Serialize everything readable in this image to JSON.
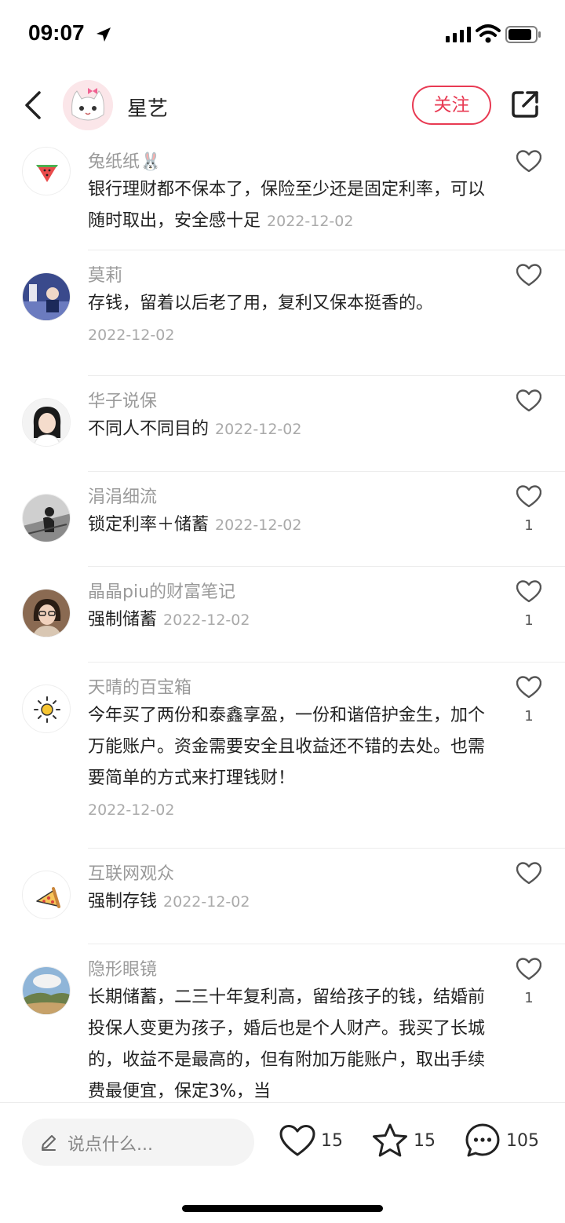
{
  "status_bar": {
    "time": "09:07"
  },
  "header": {
    "name": "星艺",
    "follow_label": "关注"
  },
  "comments": [
    {
      "name": "兔纸纸🐰",
      "text": "银行理财都不保本了，保险至少还是固定利率，可以随时取出，安全感十足",
      "date": "2022-12-02",
      "likes": "",
      "avatar": "watermelon-avatar"
    },
    {
      "name": "莫莉",
      "text": "存钱，留着以后老了用，复利又保本挺香的。",
      "date": "2022-12-02",
      "likes": "",
      "avatar": "photo-avatar"
    },
    {
      "name": "华子说保",
      "text": "不同人不同目的",
      "date": "2022-12-02",
      "likes": "",
      "avatar": "portrait-avatar"
    },
    {
      "name": "涓涓细流",
      "text": "锁定利率＋储蓄",
      "date": "2022-12-02",
      "likes": "1",
      "avatar": "bw-photo-avatar"
    },
    {
      "name": "晶晶piu的财富笔记",
      "text": "强制储蓄",
      "date": "2022-12-02",
      "likes": "1",
      "avatar": "portrait-avatar"
    },
    {
      "name": "天晴的百宝箱",
      "text": "今年买了两份和泰鑫享盈，一份和谐倍护金生，加个万能账户。资金需要安全且收益还不错的去处。也需要简单的方式来打理钱财！",
      "date": "2022-12-02",
      "likes": "1",
      "avatar": "sun-avatar"
    },
    {
      "name": "互联网观众",
      "text": "强制存钱",
      "date": "2022-12-02",
      "likes": "",
      "avatar": "pizza-avatar"
    },
    {
      "name": "隐形眼镜",
      "text": "长期储蓄，二三十年复利高，留给孩子的钱，结婚前投保人变更为孩子，婚后也是个人财产。我买了长城的，收益不是最高的，但有附加万能账户，取出手续费最便宜，保定3%，当",
      "date": "",
      "likes": "1",
      "avatar": "landscape-avatar"
    }
  ],
  "bottom_bar": {
    "input_placeholder": "说点什么...",
    "like_count": "15",
    "favorite_count": "15",
    "comment_count": "105"
  },
  "colors": {
    "accent": "#e83a53",
    "muted_text": "#9a9a9a",
    "date_text": "#aaaaaa"
  },
  "icons": [
    "back-icon",
    "share-icon",
    "heart-icon",
    "star-icon",
    "comment-icon",
    "pen-icon",
    "location-arrow-icon",
    "signal-icon",
    "wifi-icon",
    "battery-icon"
  ]
}
